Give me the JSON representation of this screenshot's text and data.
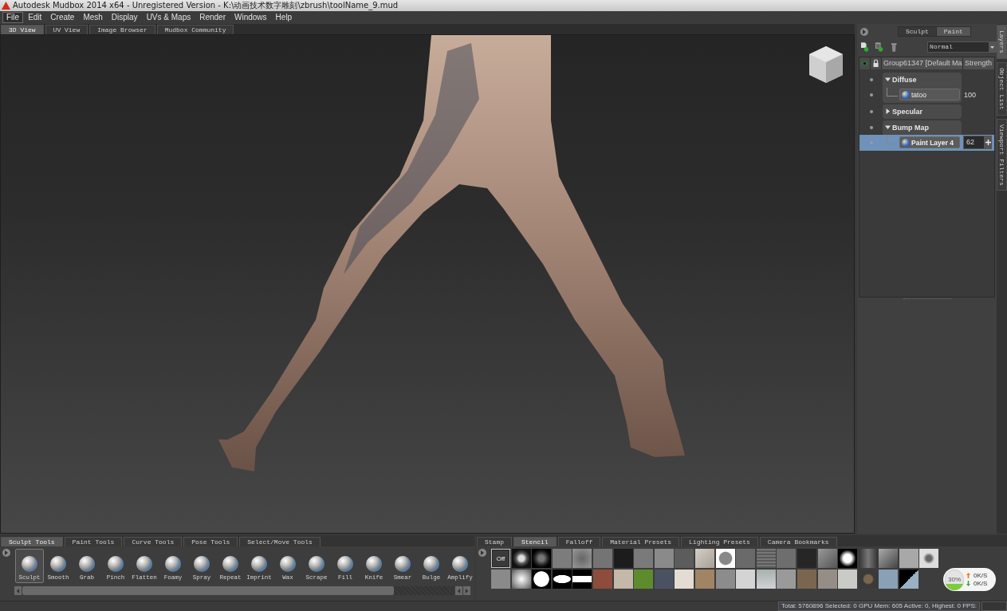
{
  "window": {
    "title": "Autodesk Mudbox 2014 x64 - Unregistered Version - K:\\动画技术数字雕刻\\zbrush\\toolName_9.mud"
  },
  "menu": [
    {
      "label": "File",
      "highlighted": true
    },
    {
      "label": "Edit",
      "highlighted": false
    },
    {
      "label": "Create",
      "highlighted": false
    },
    {
      "label": "Mesh",
      "highlighted": false
    },
    {
      "label": "Display",
      "highlighted": false
    },
    {
      "label": "UVs & Maps",
      "highlighted": false
    },
    {
      "label": "Render",
      "highlighted": false
    },
    {
      "label": "Windows",
      "highlighted": false
    },
    {
      "label": "Help",
      "highlighted": false
    }
  ],
  "view_tabs": [
    {
      "label": "3D View",
      "selected": true
    },
    {
      "label": "UV View",
      "selected": false
    },
    {
      "label": "Image Browser",
      "selected": false
    },
    {
      "label": "Mudbox Community",
      "selected": false
    }
  ],
  "layers_panel": {
    "mode_tabs": [
      {
        "label": "Sculpt",
        "selected": false
      },
      {
        "label": "Paint",
        "selected": true
      }
    ],
    "blend_mode": "Normal",
    "header": {
      "name": "Group61347 [Default Ma",
      "strength": "Strength"
    },
    "channels": [
      {
        "name": "Diffuse",
        "expanded": true,
        "layers": [
          {
            "name": "tatoo",
            "strength": "100",
            "selected": false
          }
        ]
      },
      {
        "name": "Specular",
        "expanded": false
      },
      {
        "name": "Bump Map",
        "expanded": true,
        "layers": [
          {
            "name": "Paint Layer 4",
            "strength": "62",
            "selected": true
          }
        ]
      }
    ]
  },
  "side_tabs": [
    {
      "label": "Layers",
      "selected": true
    },
    {
      "label": "Object List",
      "selected": false
    },
    {
      "label": "Viewport Filters",
      "selected": false
    }
  ],
  "tool_tray": {
    "tabs": [
      {
        "label": "Sculpt Tools",
        "selected": true
      },
      {
        "label": "Paint Tools",
        "selected": false
      },
      {
        "label": "Curve Tools",
        "selected": false
      },
      {
        "label": "Pose Tools",
        "selected": false
      },
      {
        "label": "Select/Move Tools",
        "selected": false
      }
    ],
    "tools": [
      {
        "label": "Sculpt",
        "selected": true
      },
      {
        "label": "Smooth",
        "selected": false
      },
      {
        "label": "Grab",
        "selected": false
      },
      {
        "label": "Pinch",
        "selected": false
      },
      {
        "label": "Flatten",
        "selected": false
      },
      {
        "label": "Foamy",
        "selected": false
      },
      {
        "label": "Spray",
        "selected": false
      },
      {
        "label": "Repeat",
        "selected": false
      },
      {
        "label": "Imprint",
        "selected": false
      },
      {
        "label": "Wax",
        "selected": false
      },
      {
        "label": "Scrape",
        "selected": false
      },
      {
        "label": "Fill",
        "selected": false
      },
      {
        "label": "Knife",
        "selected": false
      },
      {
        "label": "Smear",
        "selected": false
      },
      {
        "label": "Bulge",
        "selected": false
      },
      {
        "label": "Amplify",
        "selected": false
      }
    ]
  },
  "presets_tray": {
    "tabs": [
      {
        "label": "Stamp",
        "selected": false
      },
      {
        "label": "Stencil",
        "selected": true
      },
      {
        "label": "Falloff",
        "selected": false
      },
      {
        "label": "Material Presets",
        "selected": false
      },
      {
        "label": "Lighting Presets",
        "selected": false
      },
      {
        "label": "Camera Bookmarks",
        "selected": false
      }
    ],
    "stencil_rows": [
      {
        "items": [
          {
            "label": "Off",
            "selected": true
          },
          {
            "selected": false
          },
          {
            "selected": false
          },
          {
            "selected": false
          },
          {
            "selected": false
          },
          {
            "selected": false
          },
          {
            "selected": false
          },
          {
            "selected": false
          },
          {
            "selected": false
          },
          {
            "selected": false
          },
          {
            "selected": false
          },
          {
            "selected": false
          },
          {
            "selected": false
          },
          {
            "selected": false
          },
          {
            "selected": false
          },
          {
            "selected": false
          },
          {
            "selected": false
          },
          {
            "selected": false
          },
          {
            "selected": false
          },
          {
            "selected": false
          },
          {
            "selected": false
          },
          {
            "selected": false
          }
        ]
      },
      {
        "items": [
          {
            "selected": false
          },
          {
            "selected": false
          },
          {
            "selected": false
          },
          {
            "selected": false
          },
          {
            "selected": false
          },
          {
            "selected": false
          },
          {
            "selected": false
          },
          {
            "selected": false
          },
          {
            "selected": false
          },
          {
            "selected": false
          },
          {
            "selected": false
          },
          {
            "selected": false
          },
          {
            "selected": false
          },
          {
            "selected": false
          },
          {
            "selected": false
          },
          {
            "selected": false
          },
          {
            "selected": false
          },
          {
            "selected": false
          },
          {
            "selected": false
          },
          {
            "selected": false
          },
          {
            "selected": false
          }
        ]
      }
    ]
  },
  "network_meter": {
    "usage": "30%",
    "level": 0.3,
    "upload": "0K/S",
    "download": "0K/S"
  },
  "status_bar": {
    "text": "Total: 5760896  Selected: 0 GPU Mem: 605  Active: 0, Highest: 0  FPS:"
  }
}
